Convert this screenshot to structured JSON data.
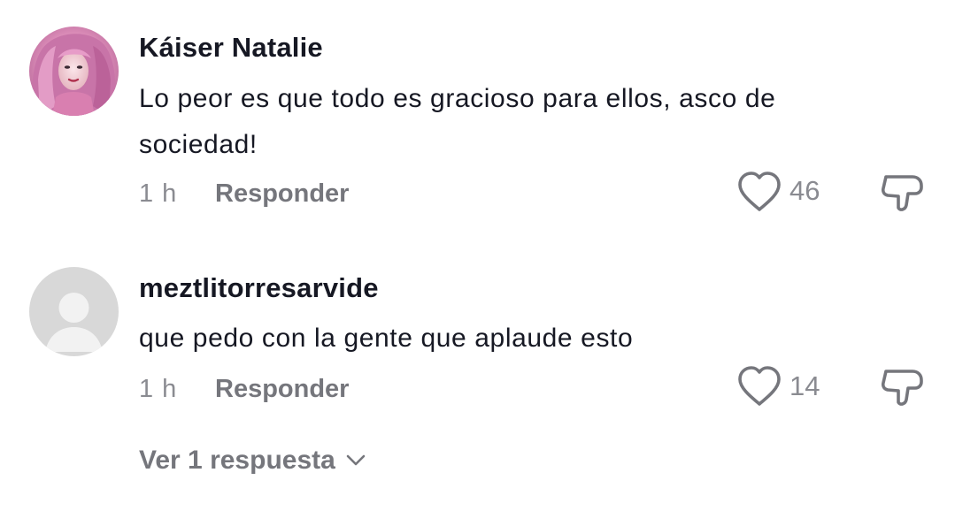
{
  "comments": [
    {
      "username": "Káiser Natalie",
      "text": "Lo peor es que todo es gracioso para ellos, asco de sociedad!",
      "time": "1 h",
      "reply_label": "Responder",
      "likes": "46",
      "avatar_icon": "pink-hair-user-avatar"
    },
    {
      "username": "meztlitorresarvide",
      "text": "que pedo con la gente que aplaude esto",
      "time": "1 h",
      "reply_label": "Responder",
      "likes": "14",
      "avatar_icon": "default-user-avatar"
    }
  ],
  "view_replies_label": "Ver 1 respuesta",
  "icons": {
    "like": "heart-outline-icon",
    "dislike": "thumbs-down-icon",
    "expand": "chevron-down-icon"
  },
  "colors": {
    "text": "#161823",
    "secondary": "#8a8b91",
    "action": "#75767c"
  }
}
